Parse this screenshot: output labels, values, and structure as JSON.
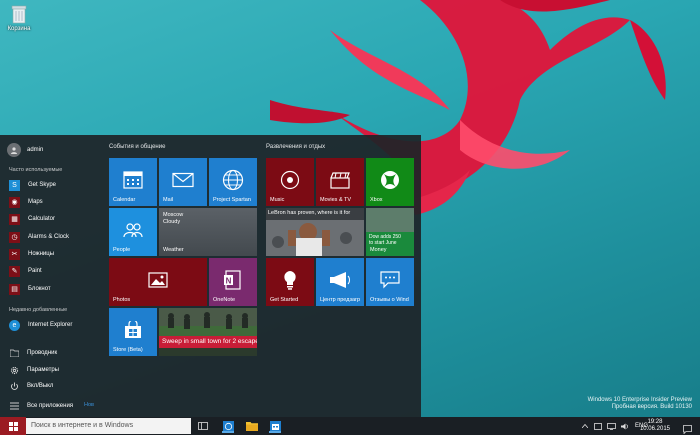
{
  "desktop": {
    "recycle_bin_label": "Корзина",
    "watermark": {
      "line1": "Windows 10 Enterprise Insider Preview",
      "line2": "Пробная версия. Build 10130"
    }
  },
  "start_menu": {
    "user_name": "admin",
    "most_used_label": "Часто используемые",
    "most_used": [
      {
        "label": "Get Skype",
        "icon": "skype-icon",
        "color": "#1e8fd6"
      },
      {
        "label": "Maps",
        "icon": "maps-icon",
        "color": "#7d0f17"
      },
      {
        "label": "Calculator",
        "icon": "calculator-icon",
        "color": "#7d0f17"
      },
      {
        "label": "Alarms & Clock",
        "icon": "alarm-icon",
        "color": "#7d0f17"
      },
      {
        "label": "Ножницы",
        "icon": "scissors-icon",
        "color": "#7d0f17"
      },
      {
        "label": "Paint",
        "icon": "paint-icon",
        "color": "#7d0f17"
      },
      {
        "label": "Блокнот",
        "icon": "notepad-icon",
        "color": "#7d0f17"
      }
    ],
    "recently_added_label": "Недавно добавленные",
    "recently_added": [
      {
        "label": "Internet Explorer",
        "icon": "ie-icon",
        "color": "#1e8fd6"
      }
    ],
    "system": [
      {
        "label": "Проводник",
        "icon": "explorer-icon"
      },
      {
        "label": "Параметры",
        "icon": "settings-icon"
      },
      {
        "label": "Вкл/Выкл",
        "icon": "power-icon"
      },
      {
        "label": "Все приложения",
        "icon": "all-apps-icon"
      }
    ],
    "new_label": "Нов",
    "group1_title": "События и общение",
    "group2_title": "Развлечения и отдых",
    "tiles": {
      "calendar": "Calendar",
      "mail": "Mail",
      "spartan": "Project Spartan",
      "people": "People",
      "weather_city": "Moscow",
      "weather_cond": "Cloudy",
      "weather": "Weather",
      "photos": "Photos",
      "onenote": "OneNote",
      "store": "Store (Beta)",
      "news_headline": "Sweep in small town for 2 escapees",
      "music": "Music",
      "movies": "Movies & TV",
      "xbox": "Xbox",
      "sport_headline": "LeBron has proven, where is it for",
      "money_line1": "Dow adds 250",
      "money_line2": "to start June",
      "money": "Money",
      "get_started": "Get Started",
      "feedback": "Центр предзагр",
      "windows_feedback": "Отзывы о Wind"
    }
  },
  "taskbar": {
    "search_placeholder": "Поиск в интернете и в Windows",
    "lang": "ENG",
    "time": "19:28",
    "date": "10.06.2015"
  }
}
